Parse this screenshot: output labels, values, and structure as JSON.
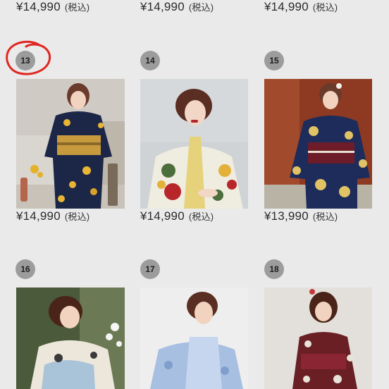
{
  "products": [
    {
      "price": "¥14,990",
      "tax": "(税込)"
    },
    {
      "price": "¥14,990",
      "tax": "(税込)"
    },
    {
      "price": "¥14,990",
      "tax": "(税込)"
    },
    {
      "number": "13",
      "price": "¥14,990",
      "tax": "(税込)"
    },
    {
      "number": "14",
      "price": "¥14,990",
      "tax": "(税込)"
    },
    {
      "number": "15",
      "price": "¥13,990",
      "tax": "(税込)"
    },
    {
      "number": "16"
    },
    {
      "number": "17"
    },
    {
      "number": "18"
    }
  ],
  "colors": {
    "background": "#eaeaea",
    "badge": "#9c9c9c",
    "highlight_circle": "#e0261f"
  }
}
